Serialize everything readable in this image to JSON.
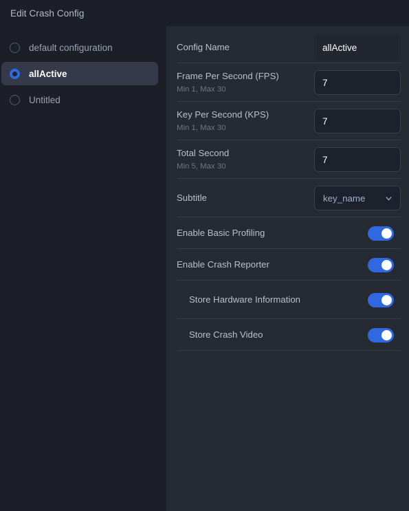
{
  "window": {
    "title": "Edit Crash Config"
  },
  "sidebar": {
    "items": [
      {
        "label": "default configuration",
        "selected": false
      },
      {
        "label": "allActive",
        "selected": true
      },
      {
        "label": "Untitled",
        "selected": false
      }
    ]
  },
  "form": {
    "config_name": {
      "label": "Config Name",
      "value": "allActive",
      "placeholder": "Config Name"
    },
    "fps": {
      "label": "Frame Per Second (FPS)",
      "hint": "Min 1, Max 30",
      "value": "7"
    },
    "kps": {
      "label": "Key Per Second (KPS)",
      "hint": "Min 1, Max 30",
      "value": "7"
    },
    "total_second": {
      "label": "Total Second",
      "hint": "Min 5, Max 30",
      "value": "7"
    },
    "subtitle": {
      "label": "Subtitle",
      "value": "key_name",
      "icon": "chevron-down-icon"
    },
    "basic_profiling": {
      "label": "Enable Basic Profiling",
      "state": "on"
    },
    "crash_reporter": {
      "label": "Enable Crash Reporter",
      "state": "on"
    },
    "store_hardware": {
      "label": "Store Hardware Information",
      "state": "on"
    },
    "store_video": {
      "label": "Store Crash Video",
      "state": "on"
    }
  },
  "colors": {
    "accent": "#2f68e0",
    "sidebar_bg": "#1c1f28",
    "panel_bg": "#252a33",
    "selected_row": "#343a49",
    "divider": "#353b47",
    "label": "#b8c0d0",
    "hint": "#6e7787"
  }
}
